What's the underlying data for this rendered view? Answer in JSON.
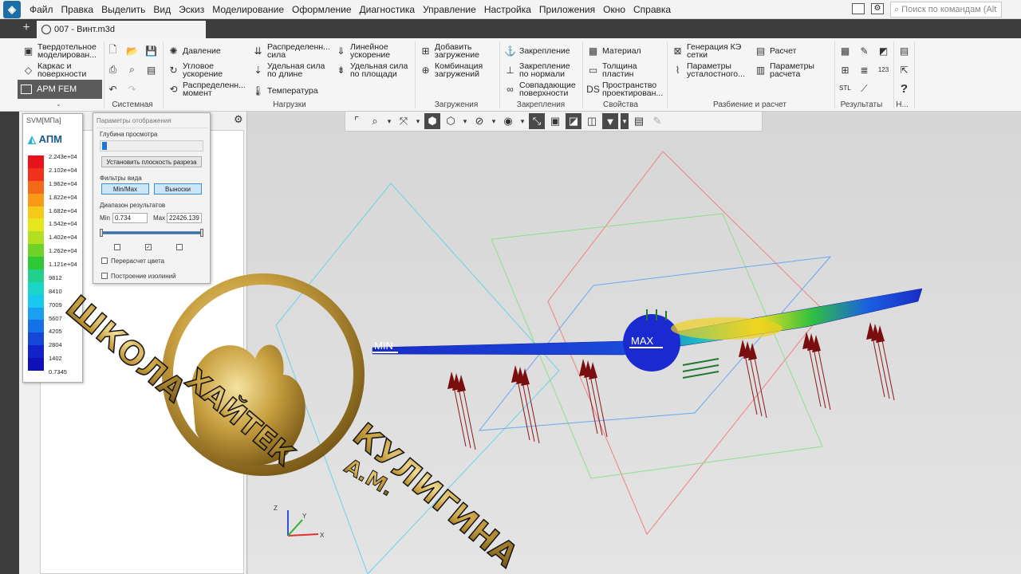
{
  "menubar": {
    "items": [
      "Файл",
      "Правка",
      "Выделить",
      "Вид",
      "Эскиз",
      "Моделирование",
      "Оформление",
      "Диагностика",
      "Управление",
      "Настройка",
      "Приложения",
      "Окно",
      "Справка"
    ],
    "search_placeholder": "Поиск по командам (Alt"
  },
  "tabs": {
    "document": "007 - Винт.m3d"
  },
  "ribbon": {
    "modes": [
      "Твердотельное моделирован...",
      "Каркас и поверхности",
      "APM FEM"
    ],
    "groups": {
      "system": "Системная",
      "loads": "Нагрузки",
      "loadings": "Загружения",
      "fixings": "Закрепления",
      "props": "Свойства",
      "mesh": "Разбиение и расчет",
      "results": "Результаты",
      "help": "Н..."
    },
    "loads_items": [
      "Давление",
      "Угловое ускорение",
      "Распределенн... момент",
      "Распределенн... сила",
      "Удельная сила по длине",
      "Температура",
      "Линейное ускорение",
      "Удельная сила по площади"
    ],
    "loadings_items": [
      "Добавить загружение",
      "Комбинация загружений"
    ],
    "fixings_items": [
      "Закрепление",
      "Закрепление по нормали",
      "Совпадающие поверхности"
    ],
    "props_items": [
      "Материал",
      "Толщина пластин",
      "Пространство проектирован..."
    ],
    "mesh_items": [
      "Генерация КЭ сетки",
      "Параметры усталостного...",
      "Расчет",
      "Параметры расчета"
    ],
    "results_icon_label": "STL"
  },
  "legend": {
    "title": "SVM[МПа]",
    "logo": "АПМ",
    "values": [
      "2.243e+04",
      "2.102e+04",
      "1.962e+04",
      "1.822e+04",
      "1.682e+04",
      "1.542e+04",
      "1.402e+04",
      "1.262e+04",
      "1.121e+04",
      "9812",
      "8410",
      "7009",
      "5607",
      "4205",
      "2804",
      "1402",
      "0.7345"
    ],
    "colors": [
      "#e8121a",
      "#f0321a",
      "#f46a18",
      "#f89a18",
      "#f6c81a",
      "#e6e61c",
      "#b2e020",
      "#6ed228",
      "#30c834",
      "#22d08c",
      "#1ad6c8",
      "#18c8ee",
      "#1aa0f0",
      "#1670e8",
      "#1446d8",
      "#1222c8",
      "#1010b8"
    ]
  },
  "params": {
    "title": "Параметры отображения",
    "depth_label": "Глубина просмотра",
    "set_plane_button": "Установить плоскость разреза",
    "filters_label": "Фильтры вида",
    "minmax_button": "Min/Max",
    "callouts_button": "Выноски",
    "range_label": "Диапазон результатов",
    "min_label": "Min",
    "min_value": "0.734",
    "max_label": "Max",
    "max_value": "22426.139",
    "recalc_label": "Перерасчет цвета",
    "isolines_label": "Построение изолиний",
    "checkbox_states": [
      false,
      true,
      false
    ]
  },
  "viewport": {
    "min_label": "MIN",
    "max_label": "MAX",
    "axis_x": "X",
    "axis_y": "Y",
    "axis_z": "Z"
  },
  "watermark": {
    "line1": "ШКОЛА",
    "line2": "ХАЙТЕК",
    "line3": "КУЛИГИНА",
    "line4": "А.М."
  }
}
